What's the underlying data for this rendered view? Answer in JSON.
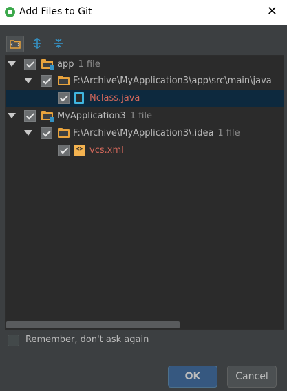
{
  "window": {
    "title": "Add Files to Git",
    "close_glyph": "✕"
  },
  "toolbar": {
    "icons": [
      "group-by-directory-icon",
      "expand-all-icon",
      "collapse-all-icon"
    ]
  },
  "tree": {
    "nodes": [
      {
        "name": "app",
        "count": "1 file",
        "type": "module",
        "checked": true,
        "expanded": true
      },
      {
        "name": "F:\\Archive\\MyApplication3\\app\\src\\main\\java",
        "count": "",
        "type": "folder",
        "checked": true,
        "expanded": true
      },
      {
        "name": "Nclass.java",
        "count": "",
        "type": "java-file",
        "checked": true,
        "selected": true
      },
      {
        "name": "MyApplication3",
        "count": "1 file",
        "type": "module",
        "checked": true,
        "expanded": true
      },
      {
        "name": "F:\\Archive\\MyApplication3\\.idea",
        "count": "1 file",
        "type": "folder",
        "checked": true,
        "expanded": true
      },
      {
        "name": "vcs.xml",
        "count": "",
        "type": "xml-file",
        "checked": true
      }
    ]
  },
  "remember": {
    "label": "Remember, don't ask again",
    "checked": false
  },
  "buttons": {
    "ok": "OK",
    "cancel": "Cancel"
  },
  "colors": {
    "background": "#3c3f41",
    "tree_bg": "#2b2b2b",
    "selection": "#0d293e",
    "unversioned_file": "#d1675a",
    "ok_button": "#365880"
  }
}
